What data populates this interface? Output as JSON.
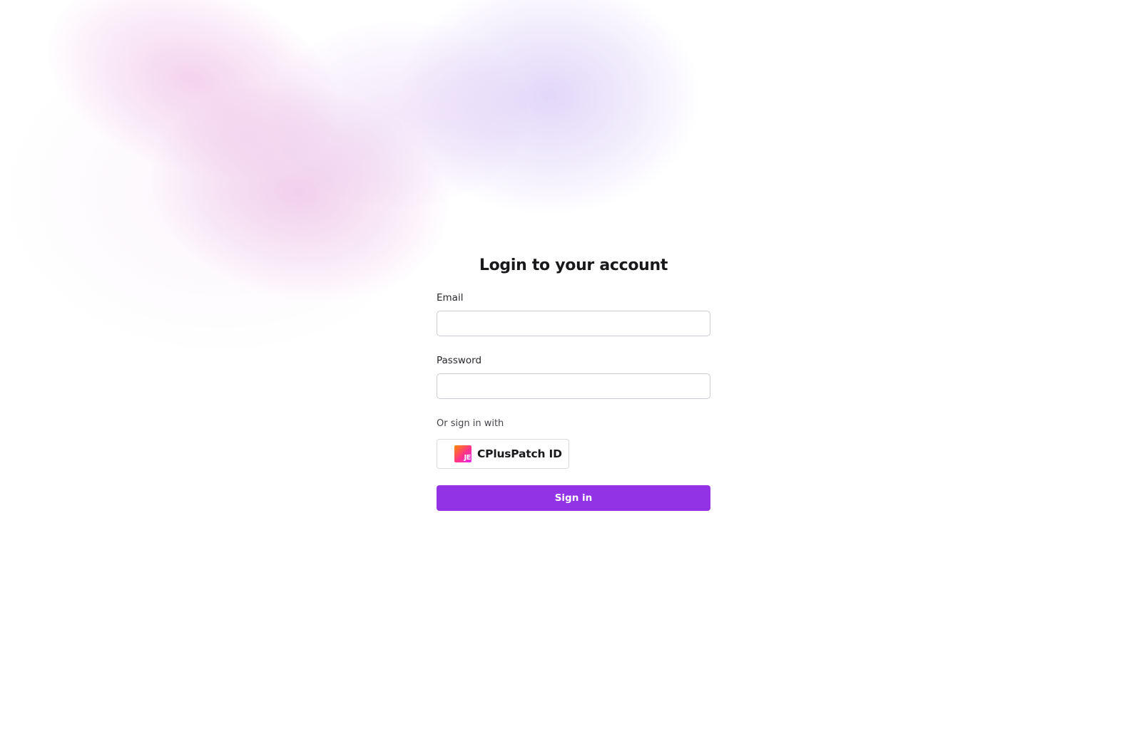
{
  "login": {
    "title": "Login to your account",
    "email": {
      "label": "Email",
      "value": "",
      "placeholder": ""
    },
    "password": {
      "label": "Password",
      "value": "",
      "placeholder": ""
    },
    "alternative": {
      "label": "Or sign in with",
      "provider_label": "CPlusPatch ID",
      "provider_logo_text": "JE",
      "provider_icon": "cpluspatch-logo-icon"
    },
    "submit_label": "Sign in"
  },
  "colors": {
    "primary": "#9233e6",
    "background": "#ffffff",
    "text": "#19191c",
    "input_border": "#c9c9cf",
    "glow_pink": "#e496d7",
    "glow_violet": "#baa0f0"
  }
}
